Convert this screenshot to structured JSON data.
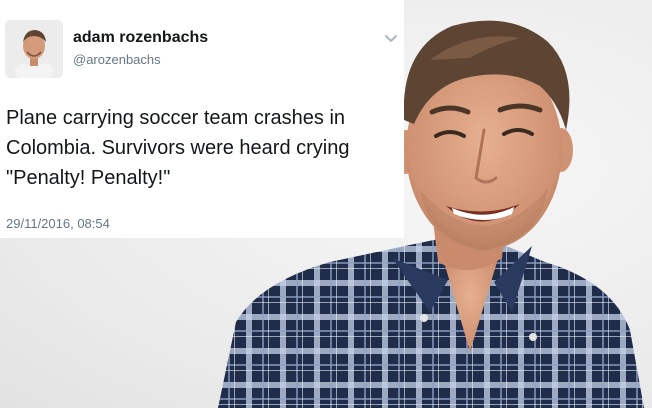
{
  "tweet": {
    "display_name": "adam rozenbachs",
    "username": "@arozenbachs",
    "text_lines": [
      "Plane carrying soccer team crashes in",
      "Colombia. Survivors were heard crying",
      "\"Penalty! Penalty!\""
    ],
    "timestamp": "29/11/2016, 08:54"
  },
  "icons": {
    "menu": "chevron-down-icon",
    "avatar": "avatar"
  },
  "colors": {
    "card_background": "#ffffff",
    "name_text": "#14171a",
    "secondary_text": "#657786",
    "shirt_navy": "#1f2c4a",
    "shirt_light": "#c6d3e8",
    "skin": "#d99f7c",
    "hair": "#5e4433"
  }
}
